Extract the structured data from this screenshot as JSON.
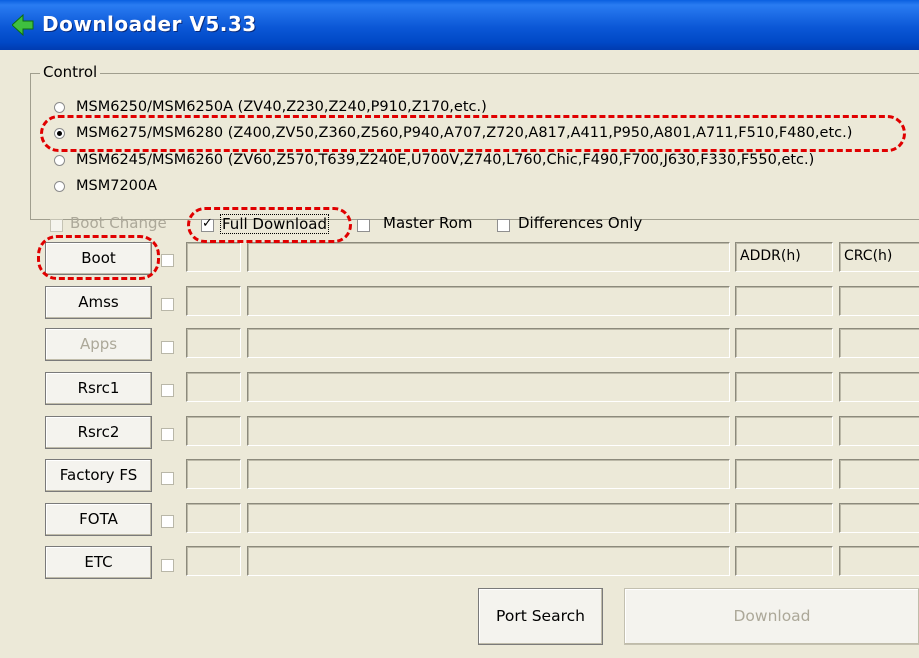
{
  "window": {
    "title": "Downloader V5.33",
    "icon": "green-arrow-icon"
  },
  "control": {
    "label": "Control",
    "chipsets": [
      {
        "label": "MSM6250/MSM6250A (ZV40,Z230,Z240,P910,Z170,etc.)",
        "selected": false
      },
      {
        "label": "MSM6275/MSM6280 (Z400,ZV50,Z360,Z560,P940,A707,Z720,A817,A411,P950,A801,A711,F510,F480,etc.)",
        "selected": true
      },
      {
        "label": "MSM6245/MSM6260 (ZV60,Z570,T639,Z240E,U700V,Z740,L760,Chic,F490,F700,J630,F330,F550,etc.)",
        "selected": false
      },
      {
        "label": "MSM7200A",
        "selected": false
      }
    ]
  },
  "options": {
    "boot_change": "Boot Change",
    "full_download": "Full Download",
    "master_rom": "Master Rom",
    "differences_only": "Differences Only"
  },
  "columns": {
    "addr": "ADDR(h)",
    "crc": "CRC(h)"
  },
  "rows": [
    {
      "label": "Boot",
      "enabled": true
    },
    {
      "label": "Amss",
      "enabled": true
    },
    {
      "label": "Apps",
      "enabled": false
    },
    {
      "label": "Rsrc1",
      "enabled": true
    },
    {
      "label": "Rsrc2",
      "enabled": true
    },
    {
      "label": "Factory FS",
      "enabled": true
    },
    {
      "label": "FOTA",
      "enabled": true
    },
    {
      "label": "ETC",
      "enabled": true
    }
  ],
  "actions": {
    "port_search": "Port Search",
    "download": "Download"
  },
  "highlight_color": "#e00000"
}
